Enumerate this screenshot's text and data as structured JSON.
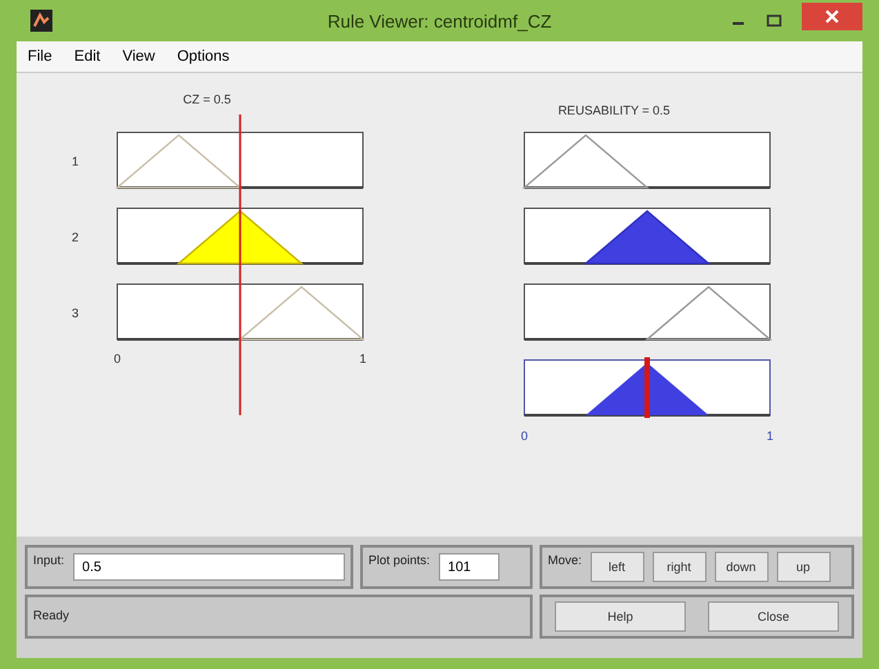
{
  "window": {
    "title": "Rule Viewer: centroidmf_CZ"
  },
  "menu": [
    "File",
    "Edit",
    "View",
    "Options"
  ],
  "input_plot": {
    "label": "CZ = 0.5",
    "level": 0.5,
    "axis": [
      "0",
      "1"
    ],
    "rules": [
      {
        "number": "1",
        "kind": "low",
        "filled": false
      },
      {
        "number": "2",
        "kind": "mid",
        "filled": true
      },
      {
        "number": "3",
        "kind": "high",
        "filled": false
      }
    ]
  },
  "output_plot": {
    "label": "REUSABILITY = 0.5",
    "level": 0.5,
    "axis": [
      "0",
      "1"
    ],
    "rules": [
      {
        "kind": "low",
        "filled": false
      },
      {
        "kind": "mid",
        "filled": true
      },
      {
        "kind": "high",
        "filled": false
      }
    ],
    "aggregate": {
      "kind": "mid"
    }
  },
  "controls": {
    "input_label": "Input:",
    "input_value": "0.5",
    "plot_points_label": "Plot points:",
    "plot_points_value": "101",
    "move_label": "Move:",
    "move_buttons": [
      "left",
      "right",
      "down",
      "up"
    ]
  },
  "status": "Ready",
  "buttons": [
    "Help",
    "Close"
  ]
}
